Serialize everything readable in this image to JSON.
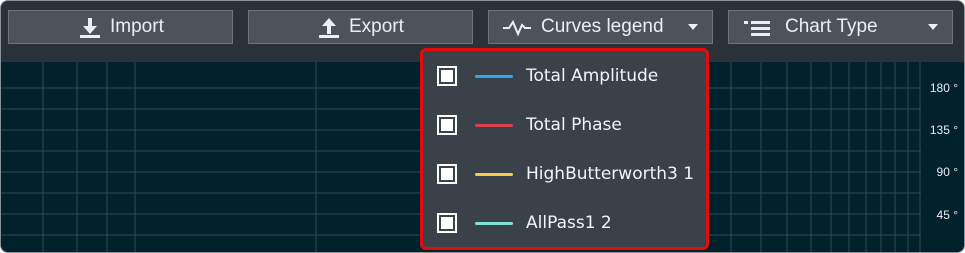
{
  "toolbar": {
    "import_label": "Import",
    "export_label": "Export",
    "curves_legend_label": "Curves legend",
    "chart_type_label": "Chart Type"
  },
  "chart": {
    "y_ticks": [
      "180 °",
      "135 °",
      "90 °",
      "45 °"
    ]
  },
  "legend": {
    "items": [
      {
        "label": "Total Amplitude",
        "color": "#29a9f0",
        "checked": true
      },
      {
        "label": "Total Phase",
        "color": "#d8404f",
        "checked": true
      },
      {
        "label": "HighButterworth3 1",
        "color": "#f7c950",
        "checked": true
      },
      {
        "label": "AllPass1 2",
        "color": "#7fe0d6",
        "checked": true
      }
    ]
  },
  "colors": {
    "toolbar_bg": "#2b3139",
    "button_bg": "#4b535b",
    "chart_bg": "#01212c",
    "dropdown_bg": "#3a4149",
    "highlight_border": "#e60a0a"
  }
}
